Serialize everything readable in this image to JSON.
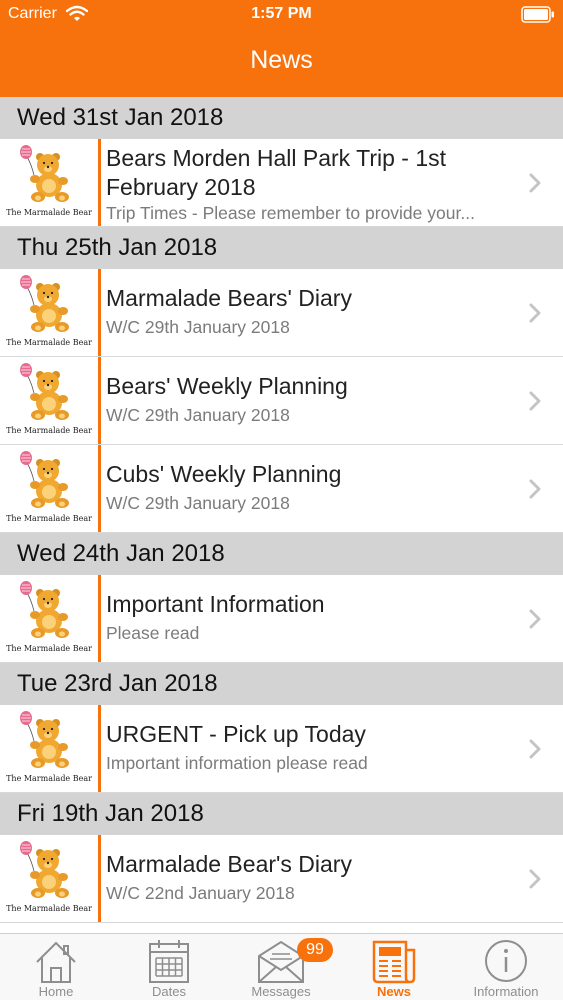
{
  "status_bar": {
    "carrier": "Carrier",
    "time": "1:57 PM"
  },
  "nav": {
    "title": "News"
  },
  "logo_text": "The Marmalade Bear",
  "sections": [
    {
      "date": "Wed 31st Jan 2018",
      "items": [
        {
          "title": "Bears Morden Hall Park Trip - 1st February 2018",
          "subtitle": "Trip Times - Please remember to provide your..."
        }
      ]
    },
    {
      "date": "Thu 25th Jan 2018",
      "items": [
        {
          "title": "Marmalade Bears' Diary",
          "subtitle": "W/C 29th January 2018"
        },
        {
          "title": "Bears' Weekly Planning",
          "subtitle": "W/C 29th January 2018"
        },
        {
          "title": "Cubs' Weekly Planning",
          "subtitle": "W/C 29th January 2018"
        }
      ]
    },
    {
      "date": "Wed 24th Jan 2018",
      "items": [
        {
          "title": "Important Information",
          "subtitle": "Please read"
        }
      ]
    },
    {
      "date": "Tue 23rd Jan 2018",
      "items": [
        {
          "title": "URGENT - Pick up Today",
          "subtitle": "Important information please read"
        }
      ]
    },
    {
      "date": "Fri 19th Jan 2018",
      "items": [
        {
          "title": "Marmalade Bear's Diary",
          "subtitle": "W/C 22nd January 2018"
        }
      ]
    }
  ],
  "tabs": [
    {
      "label": "Home",
      "icon": "home-icon"
    },
    {
      "label": "Dates",
      "icon": "calendar-icon"
    },
    {
      "label": "Messages",
      "icon": "envelope-icon",
      "badge": "99"
    },
    {
      "label": "News",
      "icon": "newspaper-icon",
      "active": true
    },
    {
      "label": "Information",
      "icon": "info-icon"
    }
  ],
  "colors": {
    "accent": "#F7720C",
    "section_bg": "#D3D3D3"
  }
}
